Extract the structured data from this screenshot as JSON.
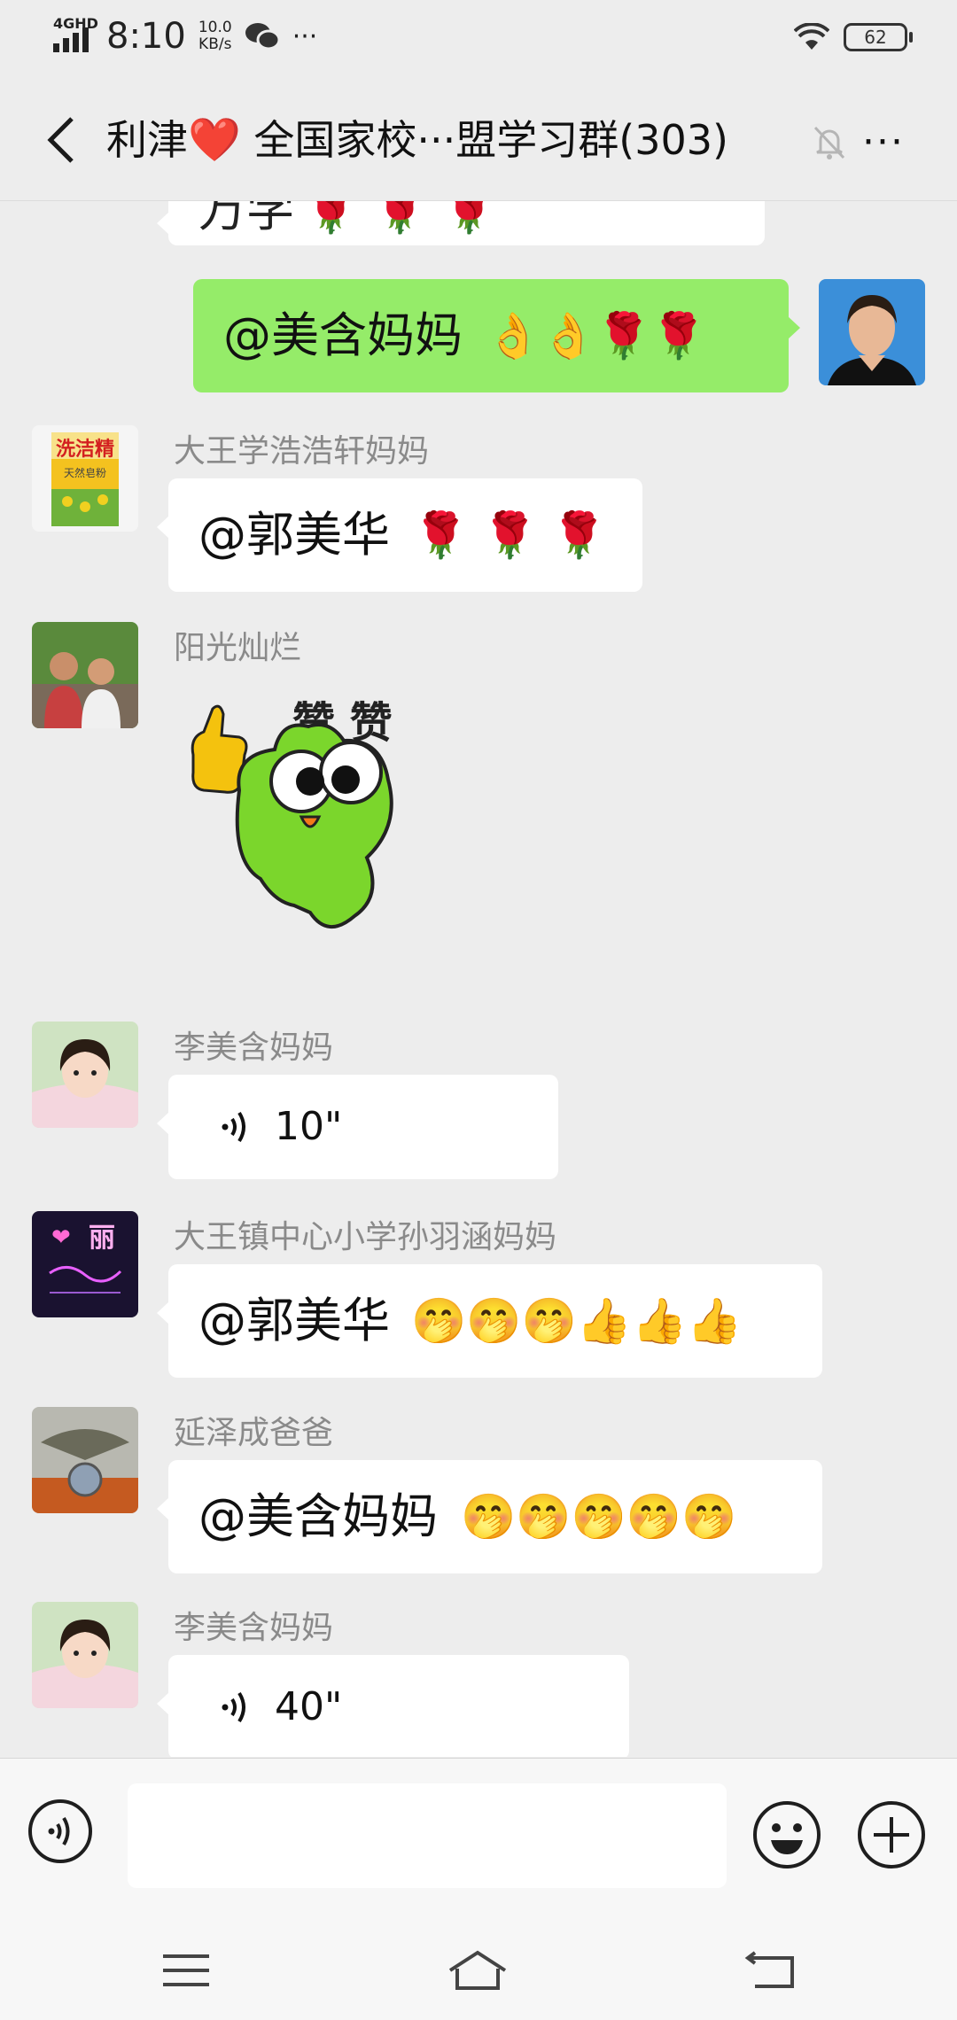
{
  "status": {
    "network": "4GHD",
    "time": "8:10",
    "speed_value": "10.0",
    "speed_unit": "KB/s",
    "more": "···",
    "battery": "62"
  },
  "header": {
    "title_prefix": "利津",
    "title_heart": "❤️",
    "title_rest": " 全国家校···盟学习群(303)",
    "more": "···"
  },
  "messages": [
    {
      "type": "text_partial",
      "sender": "",
      "text": "万学",
      "emojis": "🌹 🌹 🌹"
    },
    {
      "type": "mine",
      "text": "@美含妈妈",
      "emojis": "👌👌🌹🌹"
    },
    {
      "type": "text",
      "sender": "大王学浩浩轩妈妈",
      "text": "@郭美华",
      "emojis": "🌹 🌹 🌹"
    },
    {
      "type": "sticker",
      "sender": "阳光灿烂",
      "sticker_text": "赞 赞"
    },
    {
      "type": "voice",
      "sender": "李美含妈妈",
      "duration": "10\""
    },
    {
      "type": "text",
      "sender": "大王镇中心小学孙羽涵妈妈",
      "text": "@郭美华",
      "emojis": "🤭🤭🤭👍👍👍"
    },
    {
      "type": "text",
      "sender": "延泽成爸爸",
      "text": "@美含妈妈",
      "emojis": "🤭🤭🤭🤭🤭"
    },
    {
      "type": "voice",
      "sender": "李美含妈妈",
      "duration": "40\""
    }
  ],
  "avatar_texts": {
    "product_brand": "洗洁精",
    "product_sub": "天然皂粉",
    "neon": "丽"
  },
  "colors": {
    "background": "#ededed",
    "mine_bubble": "#95ec69",
    "other_bubble": "#ffffff",
    "sender_name": "#8a8a8a"
  },
  "icons": [
    "back-icon",
    "mute-icon",
    "more-icon",
    "voice-mode-icon",
    "emoji-icon",
    "plus-icon",
    "menu-icon",
    "home-icon",
    "back-nav-icon",
    "wifi-icon",
    "battery-icon",
    "wechat-icon",
    "signal-icon"
  ]
}
